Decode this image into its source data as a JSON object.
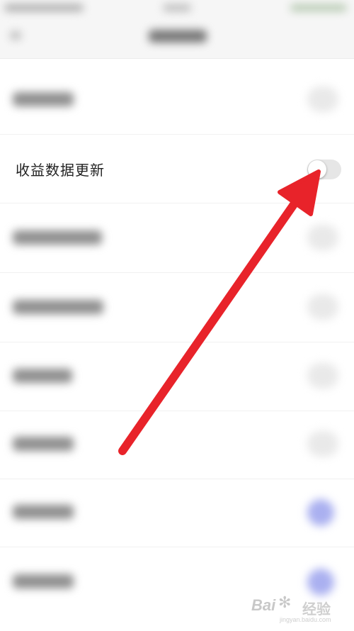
{
  "settings": {
    "focused_item": {
      "label": "收益数据更新",
      "toggle_state": "off"
    }
  },
  "colors": {
    "annotation_arrow": "#e8232a",
    "toggle_track_off": "#e6e6e6",
    "toggle_on_blurred": "#aab0f0"
  },
  "watermark": {
    "brand": "Bai",
    "brand_cn": "经验",
    "url": "jingyan.baidu.com"
  }
}
